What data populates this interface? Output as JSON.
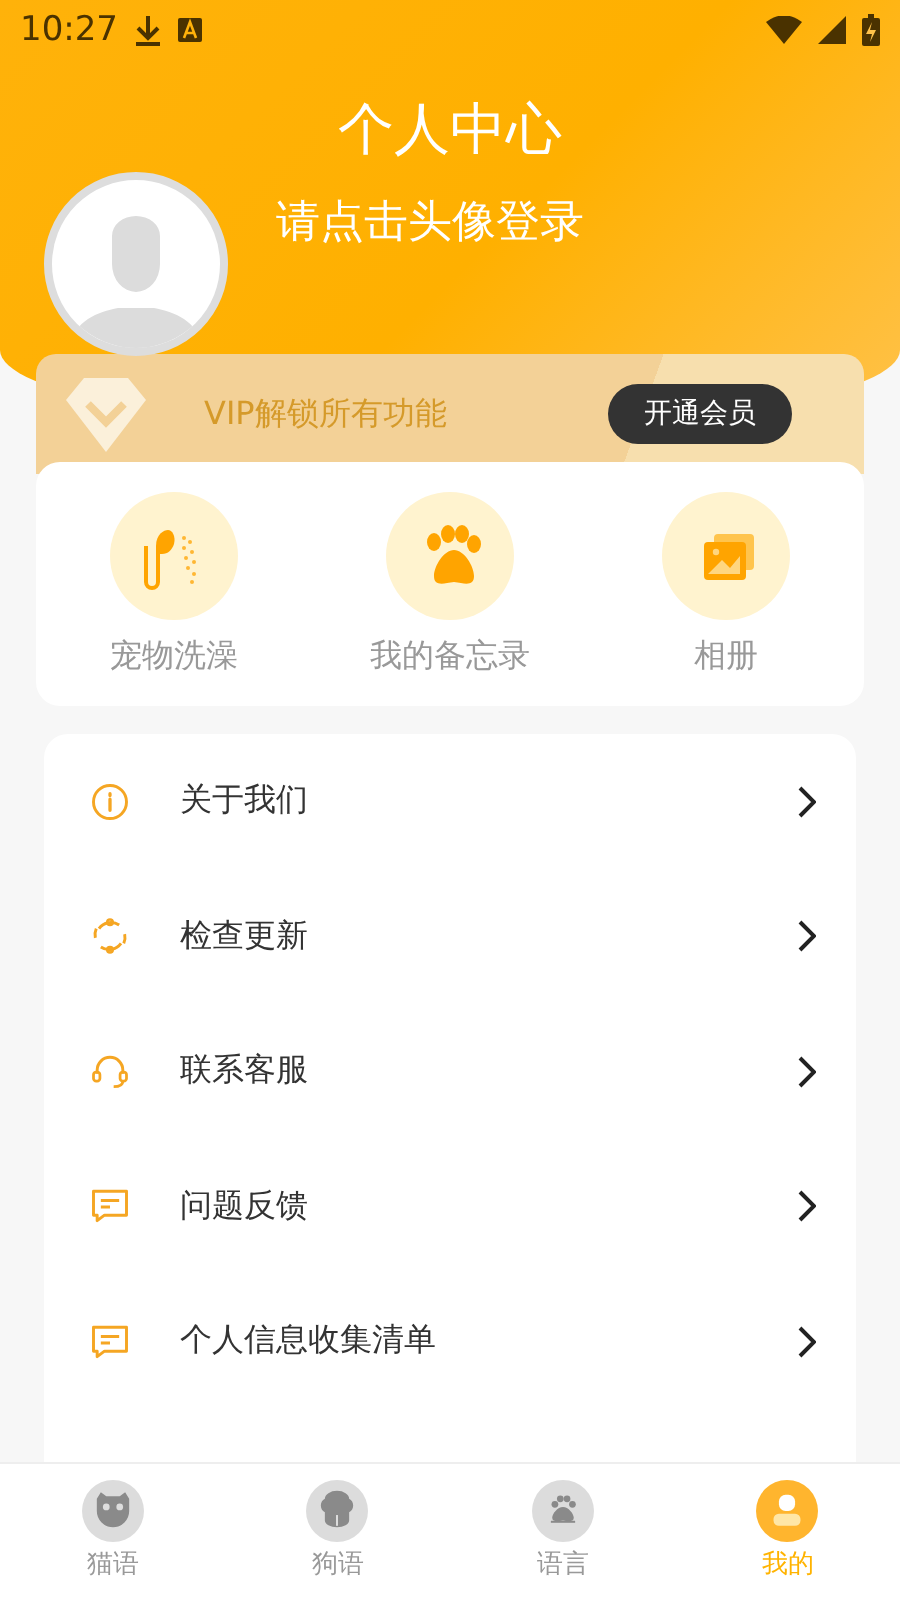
{
  "status_bar": {
    "time": "10:27"
  },
  "header": {
    "title": "个人中心",
    "login_prompt": "请点击头像登录"
  },
  "vip_banner": {
    "text": "VIP解锁所有功能",
    "button": "开通会员"
  },
  "shortcuts": [
    {
      "label": "宠物洗澡"
    },
    {
      "label": "我的备忘录"
    },
    {
      "label": "相册"
    }
  ],
  "menu": [
    {
      "label": "关于我们"
    },
    {
      "label": "检查更新"
    },
    {
      "label": "联系客服"
    },
    {
      "label": "问题反馈"
    },
    {
      "label": "个人信息收集清单"
    }
  ],
  "bottom_nav": [
    {
      "label": "猫语",
      "selected": false
    },
    {
      "label": "狗语",
      "selected": false
    },
    {
      "label": "语言",
      "selected": false
    },
    {
      "label": "我的",
      "selected": true
    }
  ]
}
